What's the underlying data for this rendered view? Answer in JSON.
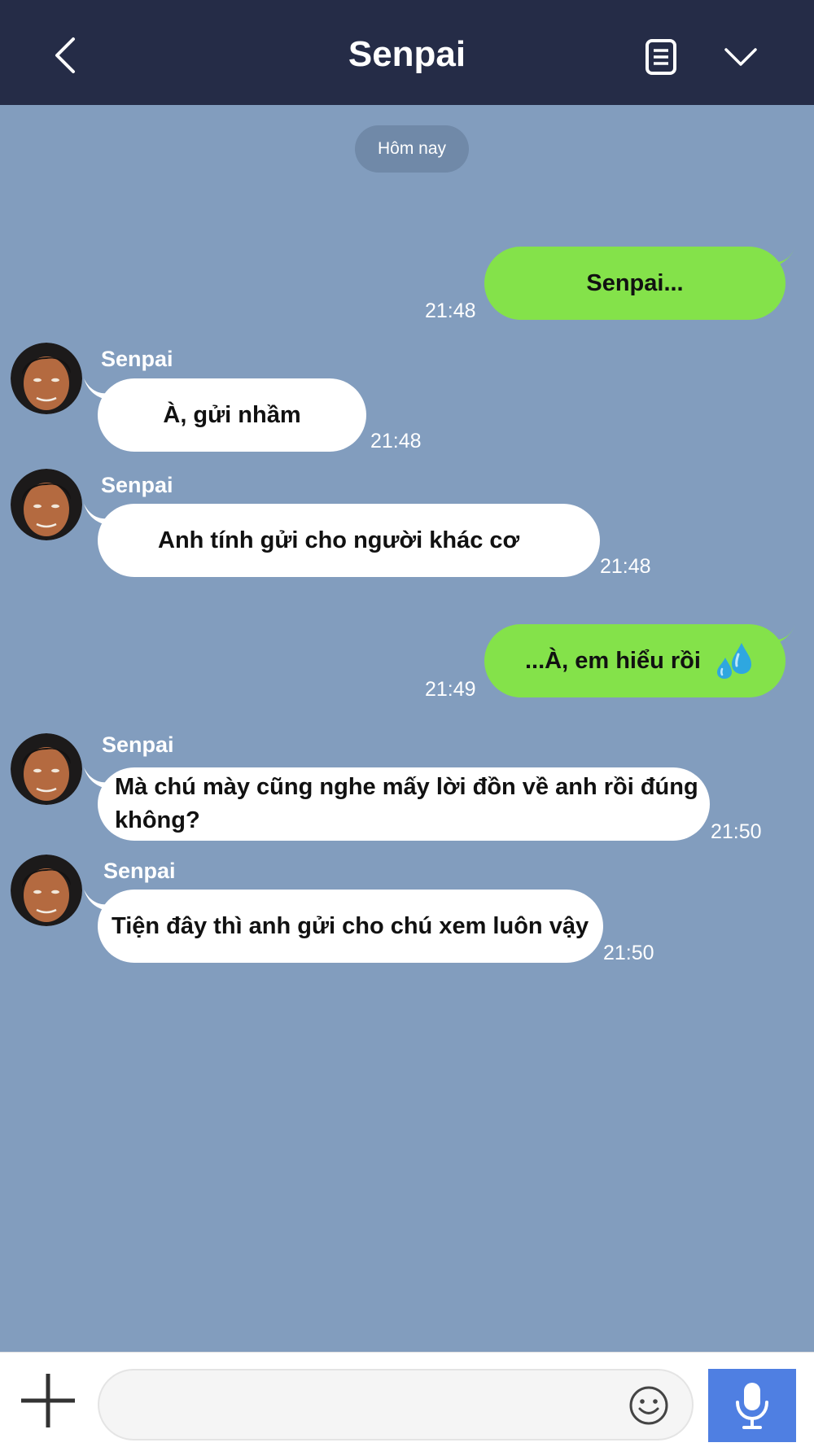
{
  "header": {
    "title": "Senpai",
    "back_icon": "chevron-left-icon",
    "notes_icon": "note-icon",
    "menu_icon": "chevron-down-icon"
  },
  "date_chip": "Hôm nay",
  "messages": [
    {
      "direction": "out",
      "text": "Senpai...",
      "time": "21:48"
    },
    {
      "direction": "in",
      "sender": "Senpai",
      "text": "À, gửi nhầm",
      "time": "21:48"
    },
    {
      "direction": "in",
      "sender": "Senpai",
      "text": "Anh tính gửi cho người khác cơ",
      "time": "21:48"
    },
    {
      "direction": "out",
      "text": "...À, em hiểu rồi",
      "emoji": "sweat-drops-icon",
      "time": "21:49"
    },
    {
      "direction": "in",
      "sender": "Senpai",
      "text": "Mà chú mày cũng nghe mấy lời đồn về anh rồi đúng không?",
      "time": "21:50"
    },
    {
      "direction": "in",
      "sender": "Senpai",
      "text": "Tiện đây thì anh gửi cho chú xem luôn vậy",
      "time": "21:50"
    }
  ],
  "input": {
    "placeholder": "",
    "value": ""
  },
  "colors": {
    "header_bg": "#252c47",
    "chat_bg": "#829dbe",
    "outgoing_bubble": "#84e24a",
    "incoming_bubble": "#ffffff",
    "mic_button": "#4f7fe2"
  }
}
